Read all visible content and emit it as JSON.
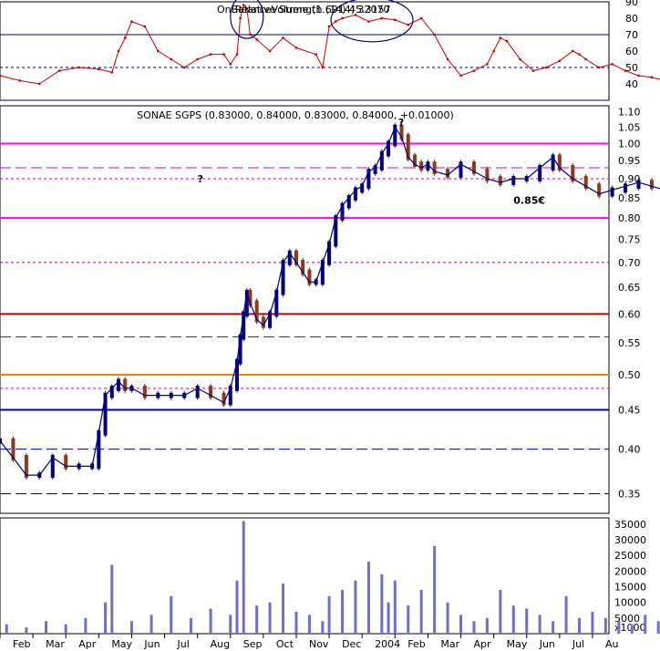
{
  "chart_data": [
    {
      "panel": "rsi",
      "type": "line",
      "title": "Relative Strength (14) 45.3157",
      "overlap_text": "OnBalanceVolume (1.6914) 32070",
      "ylim": [
        30,
        90
      ],
      "yticks": [
        "40",
        "50",
        "60",
        "70",
        "80",
        "90"
      ],
      "ref_lines": [
        {
          "value": 70,
          "color": "#000080",
          "style": "solid"
        },
        {
          "value": 50,
          "color": "#000080",
          "style": "dotted"
        },
        {
          "value": 30,
          "color": "#000080",
          "style": "solid"
        }
      ],
      "series": [
        {
          "color": "#cc0000",
          "x": [
            0,
            6,
            12,
            18,
            24,
            30,
            34,
            36,
            38,
            40,
            44,
            48,
            52,
            56,
            60,
            64,
            68,
            70,
            72,
            73,
            74,
            75,
            76,
            78,
            82,
            86,
            90,
            96,
            98,
            100,
            102,
            104,
            108,
            112,
            116,
            120,
            124,
            128,
            132,
            136,
            140,
            144,
            148,
            150,
            152,
            154,
            158,
            162,
            166,
            170,
            174,
            176,
            178,
            182,
            186,
            190,
            194,
            198,
            202,
            204,
            206,
            208,
            212,
            218,
            224,
            230,
            232,
            234,
            238,
            242,
            246,
            250,
            254
          ],
          "y": [
            45,
            42,
            40,
            48,
            50,
            49,
            47,
            60,
            68,
            78,
            75,
            60,
            55,
            50,
            55,
            58,
            58,
            52,
            58,
            80,
            88,
            86,
            70,
            67,
            60,
            68,
            62,
            58,
            50,
            75,
            78,
            80,
            82,
            78,
            80,
            79,
            76,
            80,
            70,
            55,
            45,
            48,
            52,
            60,
            68,
            66,
            55,
            48,
            50,
            54,
            60,
            58,
            55,
            50,
            52,
            48,
            45,
            44,
            42,
            40,
            38,
            35,
            37,
            45,
            50,
            48,
            45,
            44,
            42,
            40,
            38,
            35,
            45
          ]
        }
      ],
      "annotations": [
        {
          "shape": "ellipse",
          "color": "#000080",
          "x": 75,
          "y": 81
        },
        {
          "shape": "ellipse",
          "color": "#000080",
          "x": 113,
          "y": 79
        }
      ]
    },
    {
      "panel": "price",
      "type": "candlestick",
      "title": "SONAE SGPS (0.83000, 0.84000, 0.83000, 0.84000, +0.01000)",
      "scale": "log",
      "ylim": [
        0.33,
        1.12
      ],
      "yticks": [
        "0.35",
        "0.40",
        "0.45",
        "0.50",
        "0.55",
        "0.60",
        "0.65",
        "0.70",
        "0.75",
        "0.80",
        "0.85",
        "0.90",
        "0.95",
        "1.00",
        "1.05",
        "1.10"
      ],
      "x": [
        0,
        4,
        8,
        12,
        16,
        20,
        24,
        28,
        30,
        32,
        34,
        36,
        38,
        40,
        44,
        48,
        52,
        56,
        60,
        64,
        68,
        70,
        72,
        73,
        74,
        75,
        76,
        78,
        80,
        82,
        84,
        86,
        88,
        90,
        92,
        94,
        96,
        98,
        100,
        102,
        104,
        106,
        108,
        110,
        112,
        114,
        116,
        118,
        120,
        122,
        124,
        126,
        128,
        130,
        132,
        136,
        140,
        144,
        148,
        152,
        156,
        160,
        164,
        168,
        170,
        174,
        178,
        182,
        186,
        190,
        194,
        198,
        202,
        204,
        206,
        208,
        210,
        212,
        214,
        216,
        218,
        220,
        222,
        224,
        226,
        228,
        230,
        232,
        234,
        236,
        238,
        240,
        242,
        244,
        246,
        248,
        250,
        252,
        254
      ],
      "close": [
        0.41,
        0.39,
        0.37,
        0.37,
        0.39,
        0.38,
        0.38,
        0.38,
        0.42,
        0.47,
        0.48,
        0.49,
        0.48,
        0.48,
        0.47,
        0.47,
        0.47,
        0.47,
        0.48,
        0.47,
        0.46,
        0.48,
        0.52,
        0.56,
        0.6,
        0.64,
        0.62,
        0.59,
        0.58,
        0.6,
        0.64,
        0.7,
        0.72,
        0.7,
        0.68,
        0.66,
        0.66,
        0.7,
        0.74,
        0.8,
        0.83,
        0.85,
        0.87,
        0.88,
        0.92,
        0.93,
        0.97,
        1.0,
        1.05,
        1.02,
        0.96,
        0.94,
        0.93,
        0.94,
        0.92,
        0.91,
        0.94,
        0.92,
        0.9,
        0.89,
        0.9,
        0.9,
        0.93,
        0.96,
        0.93,
        0.9,
        0.88,
        0.86,
        0.87,
        0.88,
        0.89,
        0.88,
        0.87,
        0.88,
        0.9,
        0.89,
        0.87,
        0.86,
        0.87,
        0.88,
        0.86,
        0.85,
        0.86,
        0.84,
        0.85,
        0.86,
        0.84,
        0.84,
        0.83,
        0.84,
        0.84,
        0.85,
        0.84,
        0.83,
        0.82,
        0.83,
        0.83,
        0.84,
        0.84
      ],
      "ref_lines": [
        {
          "value": 1.0,
          "color": "#ff00ff",
          "style": "solid"
        },
        {
          "value": 0.93,
          "color": "#cc00cc",
          "style": "dashed"
        },
        {
          "value": 0.9,
          "color": "#cc00cc",
          "style": "dotted"
        },
        {
          "value": 0.8,
          "color": "#ff00ff",
          "style": "solid"
        },
        {
          "value": 0.7,
          "color": "#9900cc",
          "style": "dotted"
        },
        {
          "value": 0.6,
          "color": "#cc0000",
          "style": "solid"
        },
        {
          "value": 0.56,
          "color": "#cc0000",
          "style": "dashed"
        },
        {
          "value": 0.5,
          "color": "#ff8000",
          "style": "solid"
        },
        {
          "value": 0.48,
          "color": "#cc00cc",
          "style": "dotted"
        },
        {
          "value": 0.45,
          "color": "#0000aa",
          "style": "solid"
        },
        {
          "value": 0.4,
          "color": "#000080",
          "style": "dashed"
        },
        {
          "value": 0.35,
          "color": "#000080",
          "style": "dashed"
        }
      ],
      "annotations": [
        {
          "text": "?",
          "color": "#ff00ff",
          "x": 60,
          "y": 0.89
        },
        {
          "text": "?",
          "color": "#ff8000",
          "x": 121,
          "y": 1.055
        },
        {
          "text": "0.85€",
          "color": "#0000aa",
          "x": 156,
          "y": 0.835
        }
      ]
    },
    {
      "panel": "volume",
      "type": "bar",
      "ylabel": "x1000",
      "ylim": [
        0,
        37000
      ],
      "yticks": [
        "5000",
        "10000",
        "15000",
        "20000",
        "25000",
        "30000",
        "35000"
      ],
      "x": [
        2,
        8,
        14,
        20,
        26,
        32,
        34,
        40,
        46,
        52,
        58,
        64,
        70,
        72,
        74,
        78,
        82,
        86,
        90,
        94,
        98,
        100,
        104,
        108,
        112,
        116,
        118,
        120,
        124,
        128,
        132,
        136,
        140,
        144,
        148,
        152,
        156,
        160,
        164,
        168,
        172,
        176,
        180,
        184,
        188,
        192,
        196,
        200,
        204,
        208,
        212,
        216,
        220,
        224,
        228,
        232,
        236,
        240,
        244,
        248,
        252
      ],
      "values": [
        3000,
        2000,
        4000,
        3000,
        5000,
        10000,
        22000,
        4000,
        6000,
        12000,
        5000,
        8000,
        6000,
        17000,
        36000,
        9000,
        10000,
        16000,
        7000,
        6000,
        4000,
        12000,
        14000,
        17000,
        23000,
        19000,
        10000,
        17000,
        9000,
        14000,
        28000,
        10000,
        6000,
        4000,
        5000,
        14000,
        9000,
        8000,
        6000,
        4000,
        12000,
        5000,
        7000,
        5000,
        4000,
        3000,
        6000,
        4000,
        5000,
        8000,
        3000,
        5000,
        4000,
        6000,
        3000,
        4000,
        6000,
        3000,
        4000,
        3000,
        4000
      ]
    }
  ],
  "x_axis": {
    "labels": [
      "Feb",
      "Mar",
      "Apr",
      "May",
      "Jun",
      "Jul",
      "Aug",
      "Sep",
      "Oct",
      "Nov",
      "Dec",
      "2004",
      "Feb",
      "Mar",
      "Apr",
      "May",
      "Jun",
      "Jul",
      "Au"
    ],
    "positions": [
      0,
      10,
      20,
      30,
      40,
      50,
      60,
      70,
      80,
      90,
      100,
      110,
      120,
      130,
      140,
      150,
      160,
      170,
      180
    ]
  }
}
